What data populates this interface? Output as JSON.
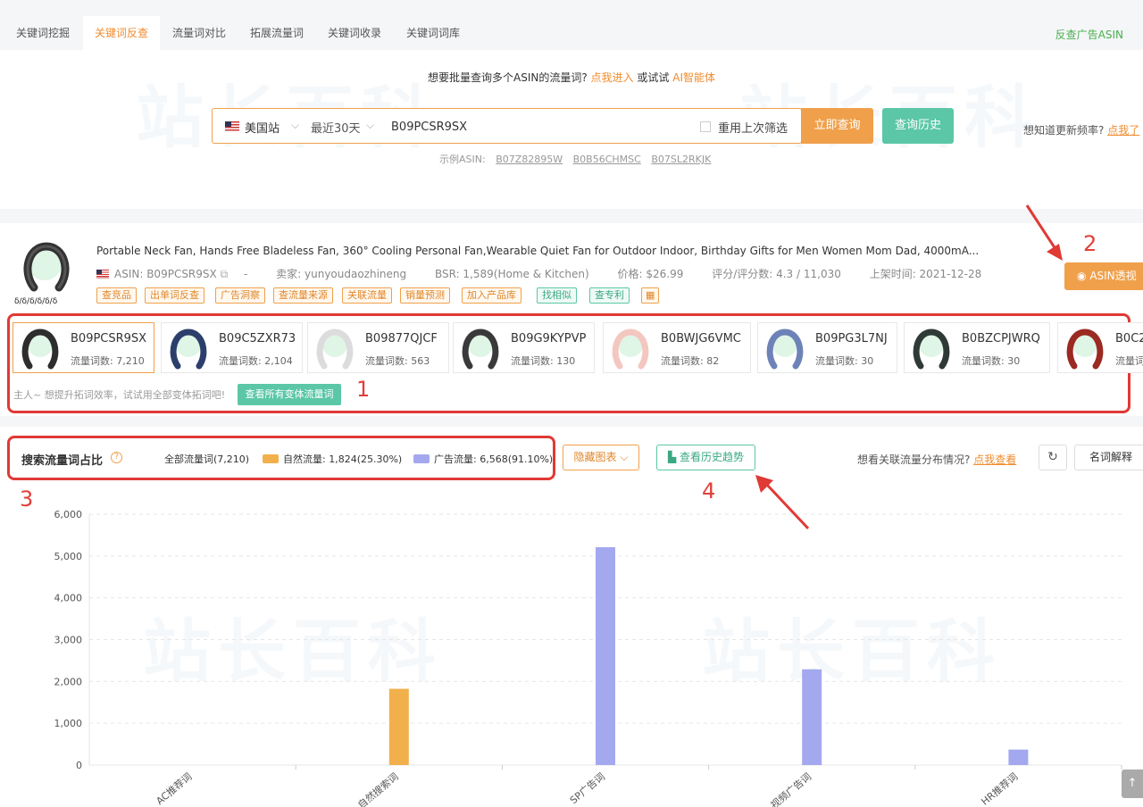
{
  "tabs": [
    {
      "label": "关键词挖掘"
    },
    {
      "label": "关键词反查"
    },
    {
      "label": "流量词对比"
    },
    {
      "label": "拓展流量词"
    },
    {
      "label": "关键词收录"
    },
    {
      "label": "关键词词库"
    }
  ],
  "tab_right": "反查广告ASIN",
  "watermark_text": "站长百科",
  "tip": {
    "prefix": "想要批量查询多个ASIN的流量词?",
    "link": "点我进入",
    "mid": "或试试",
    "ai": "AI智能体"
  },
  "search": {
    "site": "美国站",
    "range": "最近30天",
    "asin_value": "B09PCSR9SX",
    "reuse_label": "重用上次筛选",
    "submit": "立即查询",
    "history": "查询历史"
  },
  "freq": {
    "text": "想知道更新频率?",
    "link": "点我了"
  },
  "examples": {
    "label": "示例ASIN:",
    "items": [
      "B07Z82895W",
      "B0B56CHMSC",
      "B07SL2RKJK"
    ]
  },
  "product": {
    "title": "Portable Neck Fan, Hands Free Bladeless Fan, 360° Cooling Personal Fan,Wearable Quiet Fan for Outdoor Indoor, Birthday Gifts for Men Women Mom Dad, 4000mA...",
    "asin": "ASIN: B09PCSR9SX",
    "dash": "-",
    "seller": "卖家: yunyoudaozhineng",
    "bsr": "BSR: 1,589(Home & Kitchen)",
    "price": "价格: $26.99",
    "rating": "评分/评分数: 4.3 / 11,030",
    "launch": "上架时间: 2021-12-28",
    "img_text": "ẟ/ẟ/ẟ/ẟ/ẟ/ẟ"
  },
  "tags": [
    "查竞品",
    "出单词反查",
    "广告洞察",
    "查流量来源",
    "关联流量",
    "销量预测",
    "加入产品库",
    "找相似",
    "查专利"
  ],
  "asin_button": "ASIN透视",
  "annotations": [
    "1",
    "2",
    "3",
    "4"
  ],
  "variants": [
    {
      "asin": "B09PCSR9SX",
      "count": "流量词数: 7,210",
      "color": "#2d2d2d"
    },
    {
      "asin": "B09C5ZXR73",
      "count": "流量词数: 2,104",
      "color": "#2c3e6b"
    },
    {
      "asin": "B09877QJCF",
      "count": "流量词数: 563",
      "color": "#dcdcdc"
    },
    {
      "asin": "B09G9KYPVP",
      "count": "流量词数: 130",
      "color": "#3a3a3a"
    },
    {
      "asin": "B0BWJG6VMC",
      "count": "流量词数: 82",
      "color": "#f3c7c0"
    },
    {
      "asin": "B09PG3L7NJ",
      "count": "流量词数: 30",
      "color": "#6d83b8"
    },
    {
      "asin": "B0BZCPJWRQ",
      "count": "流量词数: 30",
      "color": "#2f3a36"
    },
    {
      "asin": "B0C2",
      "count": "流量词",
      "color": "#9b2a22"
    }
  ],
  "hint": "主人~ 想提升拓词效率，试试用全部变体拓词吧!",
  "variants_button": "查看所有变体流量词",
  "chart_header": {
    "title": "搜索流量词占比",
    "all": "全部流量词(7,210)",
    "natural": "自然流量: 1,824(25.30%)",
    "ad": "广告流量: 6,568(91.10%)",
    "hide_button": "隐藏图表",
    "trend_button": "查看历史趋势",
    "related_text": "想看关联流量分布情况?",
    "related_link": "点我查看",
    "explain_button": "名词解释"
  },
  "colors": {
    "natural": "#f2b04c",
    "ad": "#a3a8ef",
    "accent": "#f0a04b",
    "green": "#5bc7a6"
  },
  "chart_data": {
    "type": "bar",
    "categories": [
      "AC推荐词",
      "自然搜索词",
      "SP广告词",
      "视频广告词",
      "HR推荐词"
    ],
    "series": [
      {
        "name": "自然流量",
        "values": [
          0,
          1824,
          0,
          0,
          0
        ]
      },
      {
        "name": "广告流量",
        "values": [
          0,
          0,
          5210,
          2290,
          370
        ]
      }
    ],
    "yticks": [
      "0",
      "1,000",
      "2,000",
      "3,000",
      "4,000",
      "5,000",
      "6,000"
    ],
    "ylim": [
      0,
      6000
    ],
    "grid": true
  }
}
